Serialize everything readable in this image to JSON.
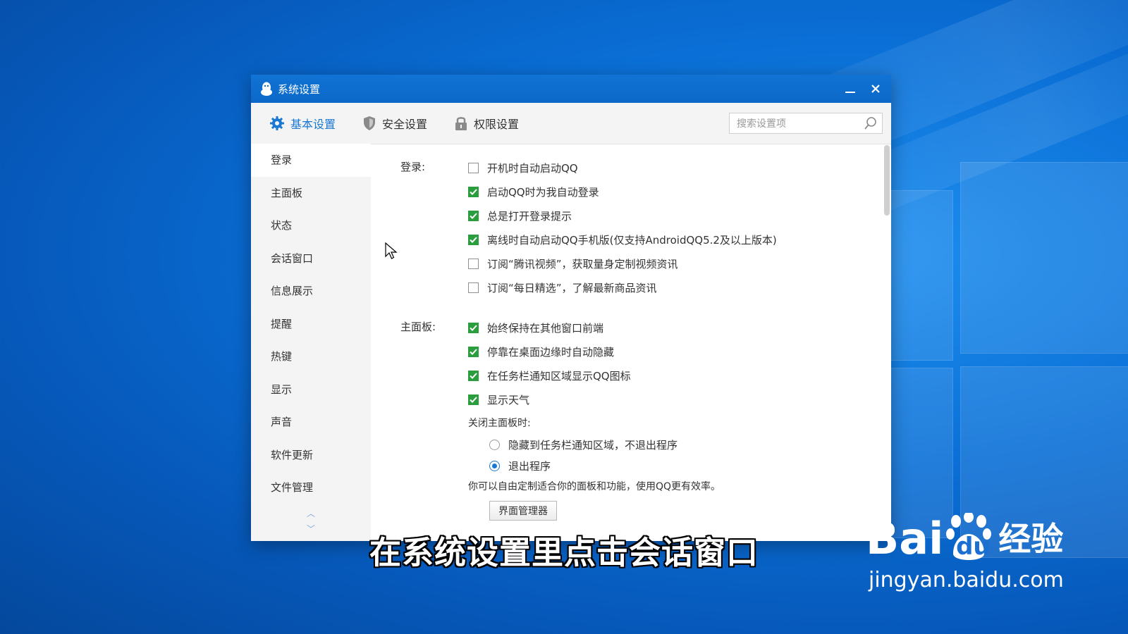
{
  "window": {
    "title": "系统设置"
  },
  "toolbar": {
    "tabs": [
      {
        "label": "基本设置",
        "icon": "gear-icon"
      },
      {
        "label": "安全设置",
        "icon": "shield-icon"
      },
      {
        "label": "权限设置",
        "icon": "lock-icon"
      }
    ],
    "search_placeholder": "搜索设置项"
  },
  "sidebar": {
    "items": [
      {
        "label": "登录"
      },
      {
        "label": "主面板"
      },
      {
        "label": "状态"
      },
      {
        "label": "会话窗口"
      },
      {
        "label": "信息展示"
      },
      {
        "label": "提醒"
      },
      {
        "label": "热键"
      },
      {
        "label": "显示"
      },
      {
        "label": "声音"
      },
      {
        "label": "软件更新"
      },
      {
        "label": "文件管理"
      }
    ],
    "selected": "登录"
  },
  "content": {
    "login": {
      "label": "登录:",
      "options": [
        {
          "label": "开机时自动启动QQ",
          "checked": false
        },
        {
          "label": "启动QQ时为我自动登录",
          "checked": true
        },
        {
          "label": "总是打开登录提示",
          "checked": true
        },
        {
          "label": "离线时自动启动QQ手机版(仅支持AndroidQQ5.2及以上版本)",
          "checked": true
        },
        {
          "label": "订阅“腾讯视频”，获取量身定制视频资讯",
          "checked": false
        },
        {
          "label": "订阅“每日精选”，了解最新商品资讯",
          "checked": false
        }
      ]
    },
    "main_panel": {
      "label": "主面板:",
      "options": [
        {
          "label": "始终保持在其他窗口前端",
          "checked": true
        },
        {
          "label": "停靠在桌面边缘时自动隐藏",
          "checked": true
        },
        {
          "label": "在任务栏通知区域显示QQ图标",
          "checked": true
        },
        {
          "label": "显示天气",
          "checked": true
        }
      ],
      "close_label": "关闭主面板时:",
      "close_options": [
        {
          "label": "隐藏到任务栏通知区域，不退出程序",
          "selected": false
        },
        {
          "label": "退出程序",
          "selected": true
        }
      ],
      "hint": "你可以自由定制适合你的面板和功能，使用QQ更有效率。",
      "button": "界面管理器"
    }
  },
  "overlay": {
    "subtitle": "在系统设置里点击会话窗口",
    "watermark_brand_left": "Bai",
    "watermark_brand_right": "du",
    "watermark_jingyan": "经验",
    "watermark_url": "jingyan.baidu.com"
  },
  "colors": {
    "accent": "#1a78d2",
    "checkbox_on": "#2a9d3d",
    "titlebar": "#0b68c8"
  }
}
